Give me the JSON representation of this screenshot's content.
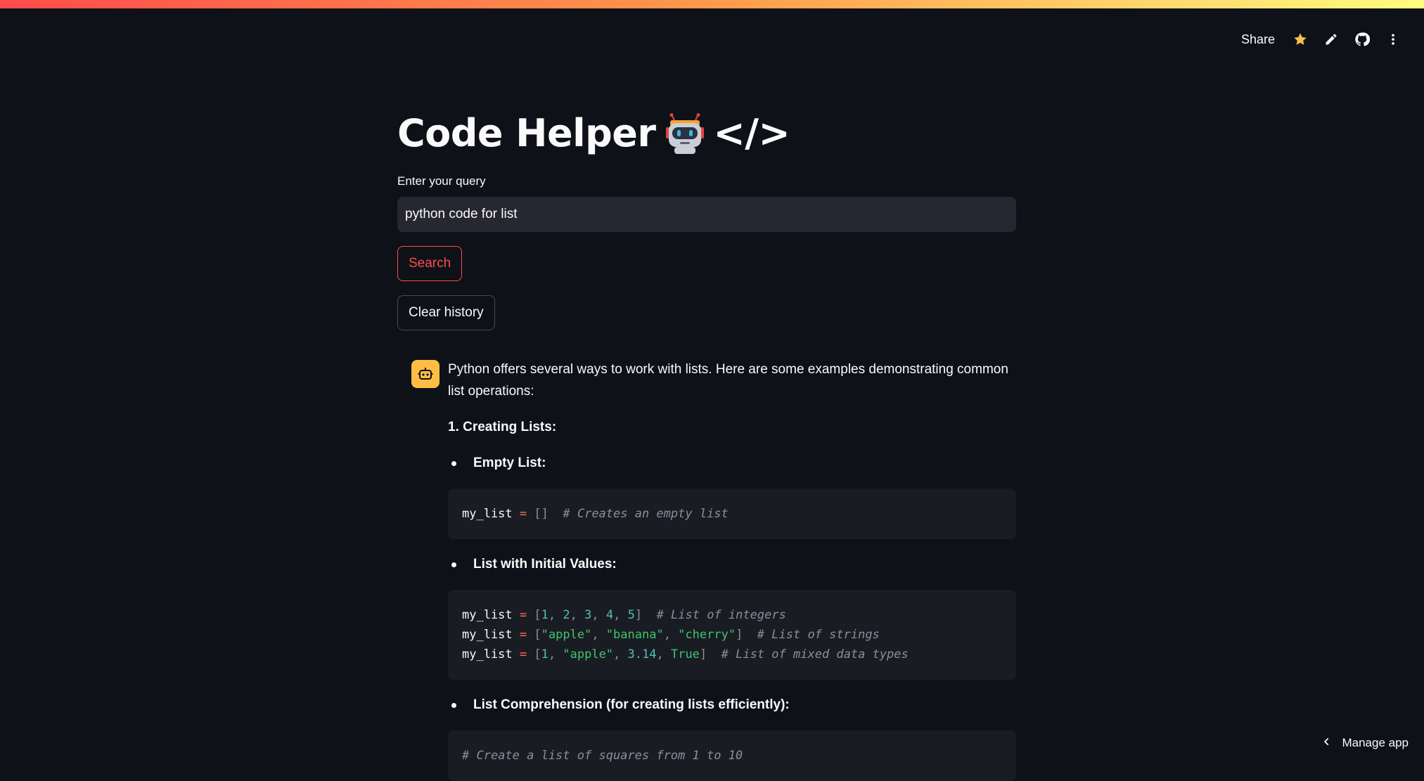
{
  "toolbar": {
    "share_label": "Share"
  },
  "colors": {
    "background": "#0e1117",
    "accent": "#ff4b4b",
    "input_bg": "#262730",
    "code_bg": "#1a1c24",
    "avatar_bg": "#ffbd45",
    "star": "#ffbd45"
  },
  "icons": [
    "star-icon",
    "pencil-icon",
    "github-icon",
    "more-vertical-icon",
    "robot-emoji-icon",
    "bot-avatar-icon",
    "chevron-left-icon"
  ],
  "app": {
    "title": "Code Helper",
    "title_suffix": "</>"
  },
  "query": {
    "label": "Enter your query",
    "value": "python code for list"
  },
  "buttons": {
    "search": "Search",
    "clear": "Clear history"
  },
  "response": {
    "intro": "Python offers several ways to work with lists. Here are some examples demonstrating common list operations:",
    "step1": "1. Creating Lists:",
    "bullets": [
      "Empty List:",
      "List with Initial Values:",
      "List Comprehension (for creating lists efficiently):"
    ],
    "code1": {
      "var": "my_list",
      "op": "=",
      "br": "[]",
      "comment": "# Creates an empty list"
    },
    "code2": {
      "var": "my_list",
      "op": "=",
      "nums": [
        "1",
        "2",
        "3",
        "4",
        "5"
      ],
      "comment1": "# List of integers",
      "strs": [
        "\"apple\"",
        "\"banana\"",
        "\"cherry\""
      ],
      "comment2": "# List of strings",
      "mixed_num1": "1",
      "mixed_str": "\"apple\"",
      "mixed_float": "3.14",
      "mixed_bool": "True",
      "comment3": "# List of mixed data types"
    },
    "code3_comment": "# Create a list of squares from 1 to 10"
  },
  "manage_app": "Manage app"
}
